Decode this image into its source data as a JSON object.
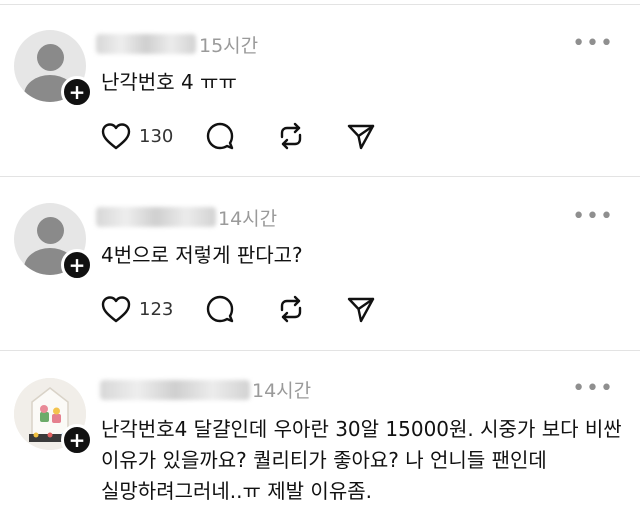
{
  "posts": [
    {
      "time": "15시간",
      "content_lines": [
        "난각번호 4 ㅠㅠ"
      ],
      "likes": "130",
      "more_label": "•••"
    },
    {
      "time": "14시간",
      "content_lines": [
        "4번으로 저렇게 판다고?"
      ],
      "likes": "123",
      "more_label": "•••"
    },
    {
      "time": "14시간",
      "content_lines": [
        "난각번호4 달걀인데 우아란 30알 15000원. 시중가 보다 비싼",
        "이유가 있을까요? 퀄리티가 좋아요? 나 언니들 팬인데",
        "실망하려그러네..ㅠ 제발 이유좀."
      ],
      "more_label": "•••"
    }
  ],
  "icons": {
    "like": "heart-icon",
    "comment": "comment-icon",
    "repost": "repost-icon",
    "share": "send-icon",
    "follow": "plus-icon"
  }
}
